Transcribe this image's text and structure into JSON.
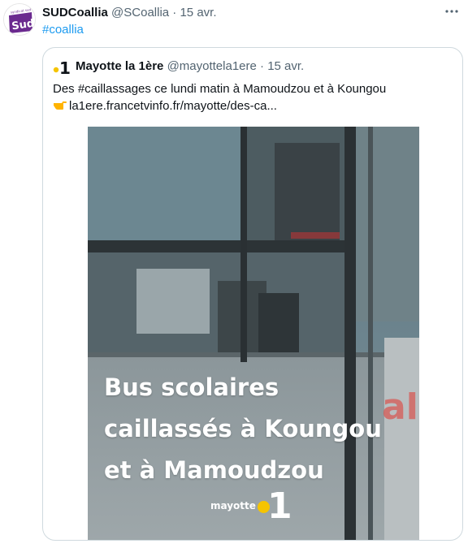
{
  "tweet": {
    "author_name": "SUDCoallia",
    "author_handle": "@SCoallia",
    "separator": "·",
    "date": "15 avr.",
    "hashtag": "#coallia",
    "avatar_text": "sud",
    "avatar_small_text": "syndicat sud",
    "more_icon": "more-horizontal-icon"
  },
  "quoted_tweet": {
    "author_name": "Mayotte la 1ère",
    "author_handle": "@mayottela1ere",
    "separator": "·",
    "date": "15 avr.",
    "text": "Des #caillassages ce lundi matin à Mamoudzou et à Koungou",
    "link_text": "la1ere.francetvinfo.fr/mayotte/des-ca...",
    "logo_icon": "la1ere-logo-icon",
    "pointer_icon": "pointing-hand-icon"
  },
  "media": {
    "overlay_lines": [
      "Bus scolaires",
      "caillassés à Koungou",
      "et à Mamoudzou"
    ],
    "brand_word": "mayotte",
    "brand_number": "1"
  },
  "colors": {
    "link": "#1d9bf0",
    "secondary_text": "#536471",
    "border": "#cfd9de",
    "brand_yellow": "#f5c400",
    "avatar_purple": "#6b2a8f"
  }
}
